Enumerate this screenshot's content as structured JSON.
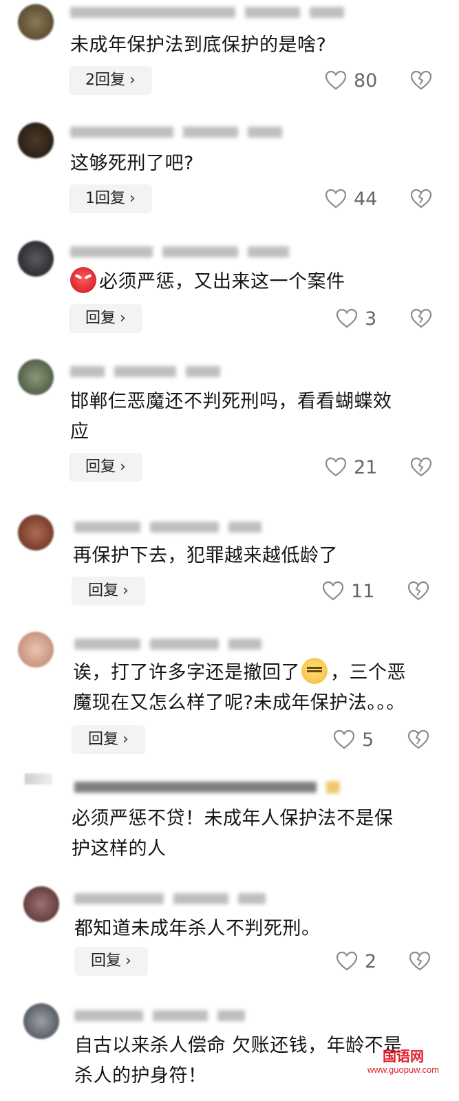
{
  "comments": [
    {
      "text": "未成年保护法到底保护的是啥?",
      "reply_label": "2回复",
      "likes": "80",
      "avatar_color": "#6b5b3e"
    },
    {
      "text": "这够死刑了吧?",
      "reply_label": "1回复",
      "likes": "44",
      "avatar_color": "#3a2a1c"
    },
    {
      "text": "必须严惩，又出来这一个案件",
      "emoji": "angry-face-emoji",
      "reply_label": "回复",
      "likes": "3",
      "avatar_color": "#2e2e33"
    },
    {
      "text_lines": [
        "邯郸仨恶魔还不判死刑吗，看看蝴蝶效",
        "应"
      ],
      "reply_label": "回复",
      "likes": "21",
      "avatar_color": "#5c6a55"
    },
    {
      "text": "再保护下去，犯罪越来越低龄了",
      "reply_label": "回复",
      "likes": "11",
      "avatar_color": "#8a4a3a"
    },
    {
      "text_a": "诶，打了许多字还是撤回了",
      "emoji": "tired-face-emoji",
      "text_b": "，三个恶",
      "text_line2": "魔现在又怎么样了呢?未成年保护法。。。",
      "reply_label": "回复",
      "likes": "5",
      "avatar_color": "#d9a894"
    },
    {
      "text_lines": [
        "必须严惩不贷！未成年人保护法不是保",
        "护这样的人"
      ],
      "avatar_color": "#f0f0f0"
    },
    {
      "text": "都知道未成年杀人不判死刑。",
      "reply_label": "回复",
      "likes": "2",
      "avatar_color": "#7a5a5a"
    },
    {
      "text_lines": [
        "自古以来杀人偿命 欠账还钱，年龄不是",
        "杀人的护身符！"
      ],
      "avatar_color": "#6e747a"
    }
  ],
  "watermark": {
    "logo": "国语网",
    "url": "www.guopuw.com"
  },
  "colors": {
    "like_icon": "#8a8a8a",
    "reply_bg": "#f2f3f5"
  }
}
